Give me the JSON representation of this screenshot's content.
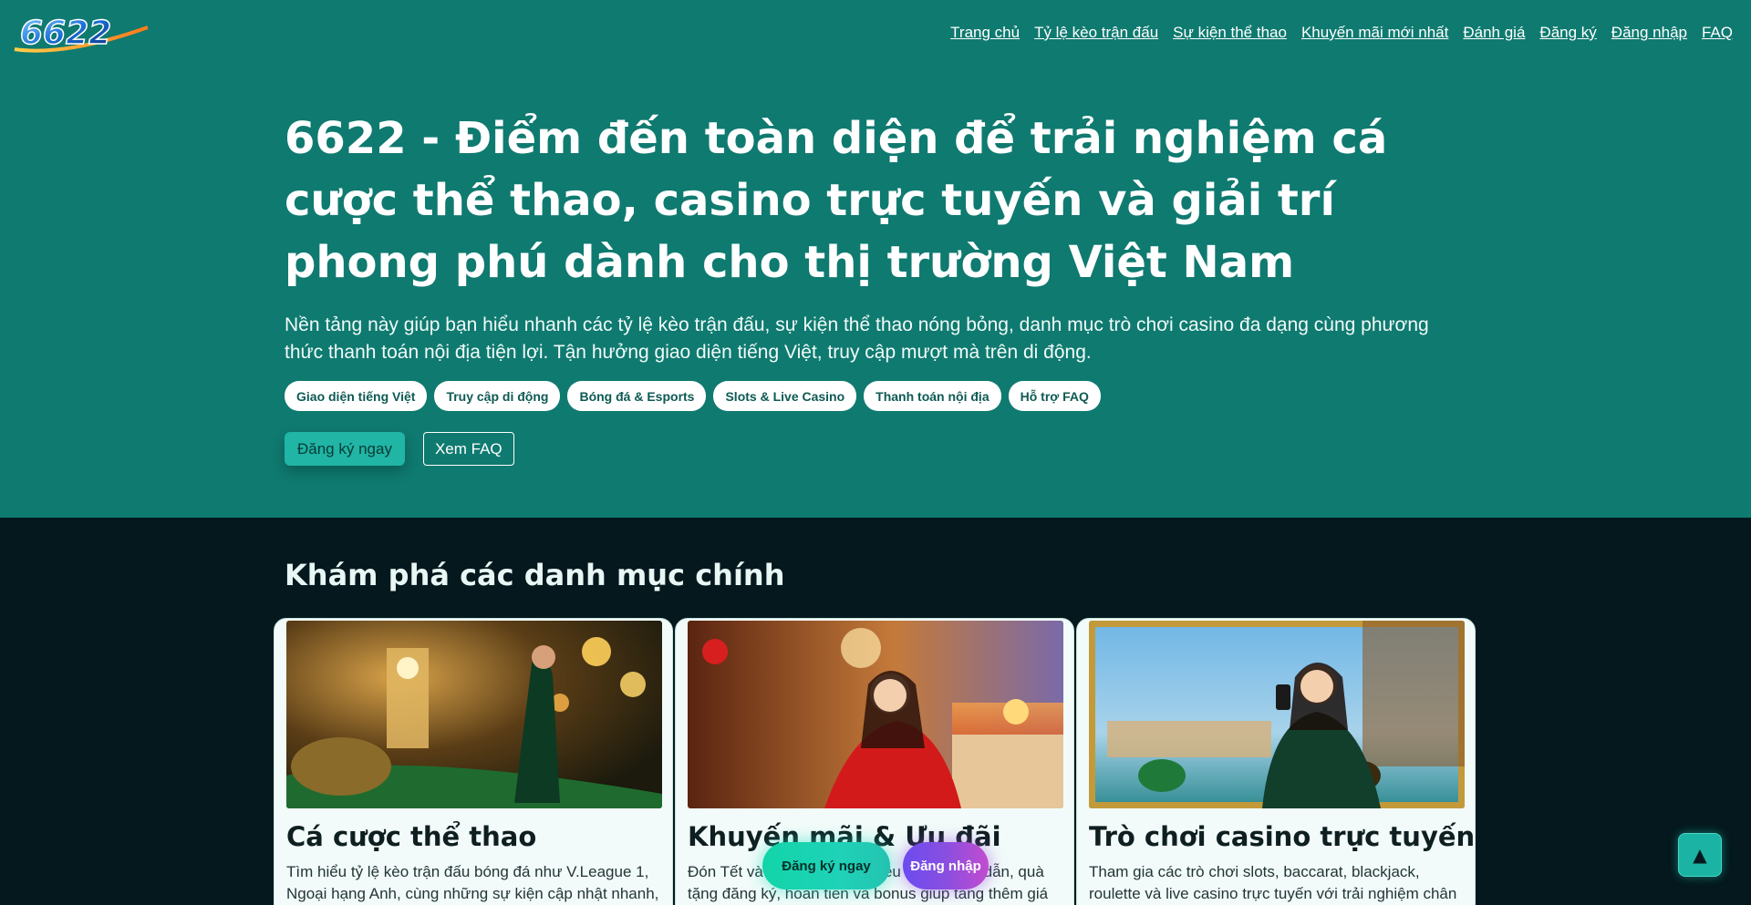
{
  "brand": {
    "logo_text": "6622"
  },
  "nav": {
    "items": [
      "Trang chủ",
      "Tỷ lệ kèo trận đấu",
      "Sự kiện thể thao",
      "Khuyến mãi mới nhất",
      "Đánh giá",
      "Đăng ký",
      "Đăng nhập",
      "FAQ"
    ]
  },
  "hero": {
    "title": "6622 - Điểm đến toàn diện để trải nghiệm cá cược thể thao, casino trực tuyến và giải trí phong phú dành cho thị trường Việt Nam",
    "description": "Nền tảng này giúp bạn hiểu nhanh các tỷ lệ kèo trận đấu, sự kiện thể thao nóng bỏng, danh mục trò chơi casino đa dạng cùng phương thức thanh toán nội địa tiện lợi. Tận hưởng giao diện tiếng Việt, truy cập mượt mà trên di động.",
    "chips": [
      "Giao diện tiếng Việt",
      "Truy cập di động",
      "Bóng đá & Esports",
      "Slots & Live Casino",
      "Thanh toán nội địa",
      "Hỗ trợ FAQ"
    ],
    "primary_cta": "Đăng ký ngay",
    "secondary_cta": "Xem FAQ"
  },
  "categories": {
    "title": "Khám phá các danh mục chính",
    "cards": [
      {
        "title": "Cá cược thể thao",
        "text": "Tìm hiểu tỷ lệ kèo trận đấu bóng đá như V.League 1, Ngoại hạng Anh, cùng những sự kiện cập nhật nhanh,"
      },
      {
        "title": "Khuyến mãi & Ưu đãi",
        "text": "Đón Tết và các dịp lễ với nhiều ưu đãi hấp dẫn, quà tặng đăng ký, hoàn tiền và bonus giúp tăng thêm giá trị trải"
      },
      {
        "title": "Trò chơi casino trực tuyến",
        "text": "Tham gia các trò chơi slots, baccarat, blackjack, roulette và live casino trực tuyến với trải nghiệm chân"
      }
    ]
  },
  "floating": {
    "register": "Đăng ký ngay",
    "login": "Đăng nhập",
    "back_to_top": "▲"
  },
  "colors": {
    "hero_bg": "#0f7a70",
    "page_bg": "#04181d",
    "accent": "#20b5a5",
    "login_gradient_start": "#6b4cf0",
    "login_gradient_end": "#c24ccf"
  }
}
